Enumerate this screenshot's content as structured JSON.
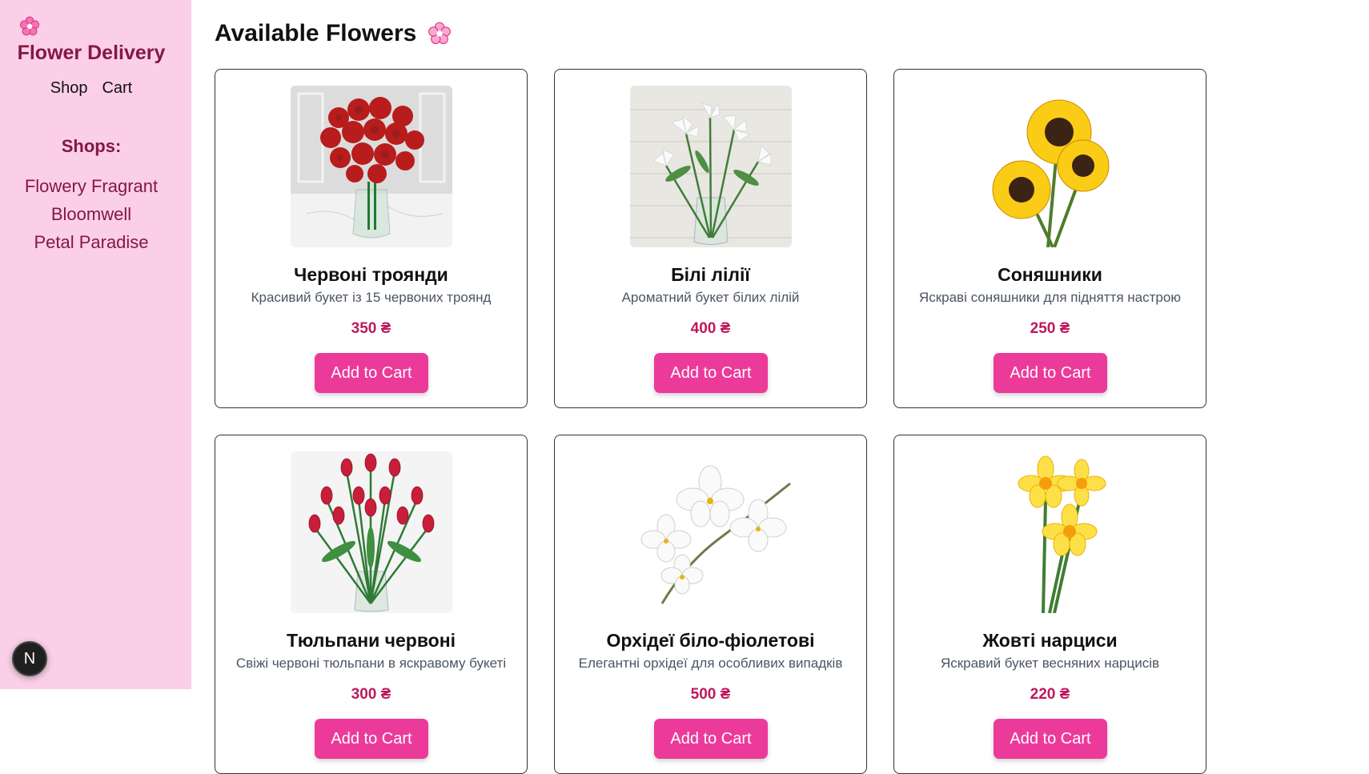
{
  "sidebar": {
    "logo_icon": "flower-icon",
    "brand": "Flower Delivery",
    "nav": [
      "Shop",
      "Cart"
    ],
    "shops_title": "Shops:",
    "shops": [
      "Flowery Fragrant",
      "Bloomwell",
      "Petal Paradise"
    ],
    "badge": "N"
  },
  "main": {
    "title": "Available Flowers",
    "title_icon": "flower-icon",
    "add_label": "Add to Cart",
    "products": [
      {
        "name": "Червоні троянди",
        "desc": "Красивий букет із 15 червоних троянд",
        "price": "350 ₴",
        "image": "red-roses-image"
      },
      {
        "name": "Білі лілії",
        "desc": "Ароматний букет білих лілій",
        "price": "400 ₴",
        "image": "white-lilies-image"
      },
      {
        "name": "Соняшники",
        "desc": "Яскраві соняшники для підняття настрою",
        "price": "250 ₴",
        "image": "sunflowers-image"
      },
      {
        "name": "Тюльпани червоні",
        "desc": "Свіжі червоні тюльпани в яскравому букеті",
        "price": "300 ₴",
        "image": "red-tulips-image"
      },
      {
        "name": "Орхідеї біло-фіолетові",
        "desc": "Елегантні орхідеї для особливих випадків",
        "price": "500 ₴",
        "image": "white-orchids-image"
      },
      {
        "name": "Жовті нарциси",
        "desc": "Яскравий букет весняних нарцисів",
        "price": "220 ₴",
        "image": "yellow-daffodils-image"
      }
    ]
  },
  "colors": {
    "sidebar_bg": "#fbcfe8",
    "brand": "#831843",
    "price": "#be185d",
    "button": "#ec3a9a"
  }
}
